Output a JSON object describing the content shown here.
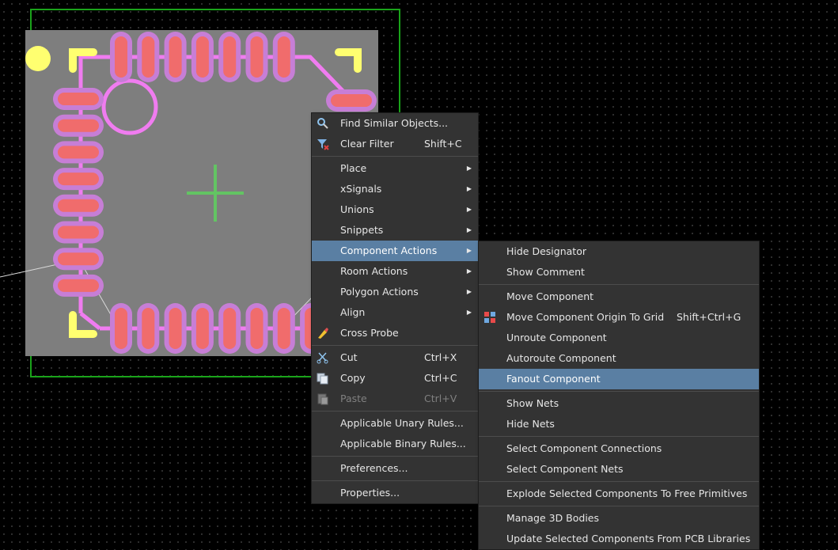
{
  "colors": {
    "board": "#7e7e7e",
    "board_outline": "#1aa31a",
    "pad": "#f06c6c",
    "pad_ring": "#c77ed6",
    "silk_magenta": "#f07cf0",
    "silk_yellow": "#ffff70",
    "highlight": "#5a7fa3",
    "menu_bg": "#333333"
  },
  "context_menu": {
    "items": [
      {
        "label": "Find Similar Objects...",
        "icon": "magnifier-icon"
      },
      {
        "label": "Clear Filter",
        "shortcut": "Shift+C",
        "icon": "filter-clear-icon"
      },
      {
        "separator": true
      },
      {
        "label": "Place",
        "submenu": true
      },
      {
        "label": "xSignals",
        "submenu": true
      },
      {
        "label": "Unions",
        "submenu": true
      },
      {
        "label": "Snippets",
        "submenu": true
      },
      {
        "label": "Component Actions",
        "submenu": true,
        "highlighted": true
      },
      {
        "label": "Room Actions",
        "submenu": true
      },
      {
        "label": "Polygon Actions",
        "submenu": true
      },
      {
        "label": "Align",
        "submenu": true
      },
      {
        "label": "Cross Probe",
        "icon": "cross-probe-icon"
      },
      {
        "separator": true
      },
      {
        "label": "Cut",
        "shortcut": "Ctrl+X",
        "icon": "scissors-icon"
      },
      {
        "label": "Copy",
        "shortcut": "Ctrl+C",
        "icon": "copy-icon"
      },
      {
        "label": "Paste",
        "shortcut": "Ctrl+V",
        "icon": "paste-icon",
        "disabled": true
      },
      {
        "separator": true
      },
      {
        "label": "Applicable Unary Rules..."
      },
      {
        "label": "Applicable Binary Rules..."
      },
      {
        "separator": true
      },
      {
        "label": "Preferences..."
      },
      {
        "separator": true
      },
      {
        "label": "Properties..."
      }
    ]
  },
  "component_actions_submenu": {
    "items": [
      {
        "label": "Hide Designator"
      },
      {
        "label": "Show Comment"
      },
      {
        "separator": true
      },
      {
        "label": "Move Component"
      },
      {
        "label": "Move Component Origin To Grid",
        "shortcut": "Shift+Ctrl+G",
        "icon": "grid-origin-icon"
      },
      {
        "label": "Unroute Component"
      },
      {
        "label": "Autoroute Component"
      },
      {
        "label": "Fanout Component",
        "highlighted": true
      },
      {
        "separator": true
      },
      {
        "label": "Show Nets"
      },
      {
        "label": "Hide Nets"
      },
      {
        "separator": true
      },
      {
        "label": "Select Component Connections"
      },
      {
        "label": "Select Component Nets"
      },
      {
        "separator": true
      },
      {
        "label": "Explode Selected Components To Free Primitives"
      },
      {
        "separator": true
      },
      {
        "label": "Manage 3D Bodies"
      },
      {
        "label": "Update Selected Components From PCB Libraries"
      }
    ]
  }
}
